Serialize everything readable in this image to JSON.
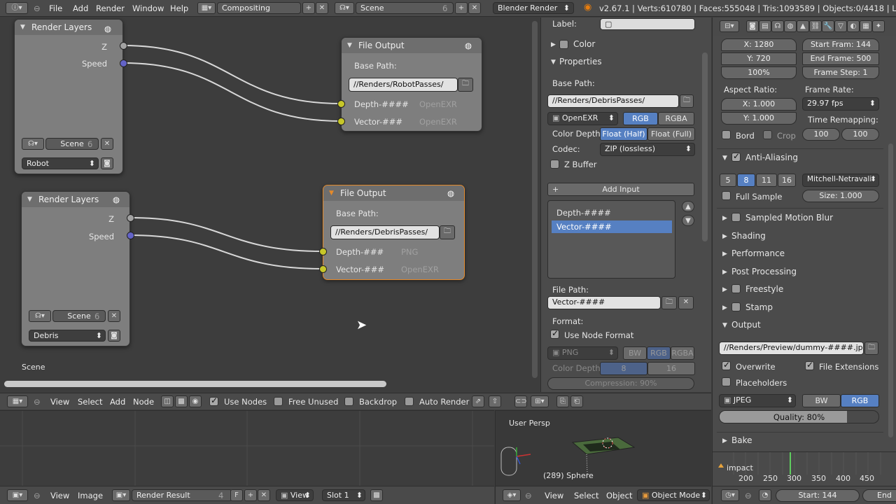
{
  "topbar": {
    "menus": [
      "File",
      "Add",
      "Render",
      "Window",
      "Help"
    ],
    "screen": "Compositing",
    "scene": "Scene",
    "scene_users": "6",
    "engine": "Blender Render",
    "stats": "v2.67.1 | Verts:610780 | Faces:555048 | Tris:1093589 | Objects:0/4418 | Lamps:0/"
  },
  "nodes": {
    "rl1": {
      "title": "Render Layers",
      "out_z": "Z",
      "out_speed": "Speed",
      "scene": "Scene",
      "scene_users": "6",
      "layer": "Robot"
    },
    "rl2": {
      "title": "Render Layers",
      "out_z": "Z",
      "out_speed": "Speed",
      "scene": "Scene",
      "scene_users": "6",
      "layer": "Debris"
    },
    "fo1": {
      "title": "File Output",
      "base_label": "Base Path:",
      "base_path": "//Renders/RobotPasses/",
      "in1": "Depth-####",
      "in1_fmt": "OpenEXR",
      "in2": "Vector-###",
      "in2_fmt": "OpenEXR"
    },
    "fo2": {
      "title": "File Output",
      "base_label": "Base Path:",
      "base_path": "//Renders/DebrisPasses/",
      "in1": "Depth-###",
      "in1_fmt": "PNG",
      "in2": "Vector-###",
      "in2_fmt": "OpenEXR"
    },
    "scene_label": "Scene"
  },
  "node_panel": {
    "label": "Label:",
    "color": "Color",
    "properties": "Properties",
    "base_path_label": "Base Path:",
    "base_path": "//Renders/DebrisPasses/",
    "format": "OpenEXR",
    "rgb": "RGB",
    "rgba": "RGBA",
    "color_depth": "Color Depth",
    "float_half": "Float (Half)",
    "float_full": "Float (Full)",
    "codec_label": "Codec:",
    "codec": "ZIP (lossless)",
    "zbuffer": "Z Buffer",
    "add_input": "Add Input",
    "inputs": [
      "Depth-####",
      "Vector-####"
    ],
    "file_path_label": "File Path:",
    "file_path": "Vector-####",
    "format_label": "Format:",
    "use_node_format": "Use Node Format",
    "fmt2": "PNG",
    "bw": "BW",
    "rgb2": "RGB",
    "rgba2": "RGBA",
    "color_depth2": "Color Depth",
    "d8": "8",
    "d16": "16",
    "compression": "Compression: 90%"
  },
  "node_toolbar": {
    "view": "View",
    "select": "Select",
    "add": "Add",
    "node": "Node",
    "use_nodes": "Use Nodes",
    "free_unused": "Free Unused",
    "backdrop": "Backdrop",
    "auto_render": "Auto Render"
  },
  "image_toolbar": {
    "view": "View",
    "image": "Image",
    "render_result": "Render Result",
    "users": "4",
    "f": "F",
    "view_sel": "View",
    "slot": "Slot 1"
  },
  "viewport": {
    "persp": "User Persp",
    "obj": "(289) Sphere"
  },
  "viewport_toolbar": {
    "view": "View",
    "select": "Select",
    "object": "Object",
    "mode": "Object Mode"
  },
  "props": {
    "res_x": "X: 1280",
    "res_y": "Y: 720",
    "res_pct": "100%",
    "start": "Start Fram: 144",
    "end": "End Frame: 500",
    "step": "Frame Step: 1",
    "aspect_label": "Aspect Ratio:",
    "asp_x": "X: 1.000",
    "asp_y": "Y: 1.000",
    "framerate_label": "Frame Rate:",
    "fps": "29.97 fps",
    "remap_label": "Time Remapping:",
    "remap_old": "100",
    "remap_new": "100",
    "border": "Bord",
    "crop": "Crop",
    "aa": "Anti-Aliasing",
    "aa_samples": [
      "5",
      "8",
      "11",
      "16"
    ],
    "aa_filter": "Mitchell-Netravali",
    "full_sample": "Full Sample",
    "aa_size": "Size: 1.000",
    "sections": [
      "Sampled Motion Blur",
      "Shading",
      "Performance",
      "Post Processing",
      "Freestyle",
      "Stamp"
    ],
    "output": "Output",
    "out_path": "//Renders/Preview/dummy-####.jpg",
    "overwrite": "Overwrite",
    "file_ext": "File Extensions",
    "placeholders": "Placeholders",
    "out_format": "JPEG",
    "bw": "BW",
    "rgb": "RGB",
    "quality": "Quality: 80%",
    "quality_value": 0.8,
    "bake": "Bake"
  },
  "timeline": {
    "label": "impact",
    "ticks": [
      "200",
      "250",
      "300",
      "350",
      "400",
      "450"
    ],
    "start": "Start: 144",
    "end": "End"
  }
}
